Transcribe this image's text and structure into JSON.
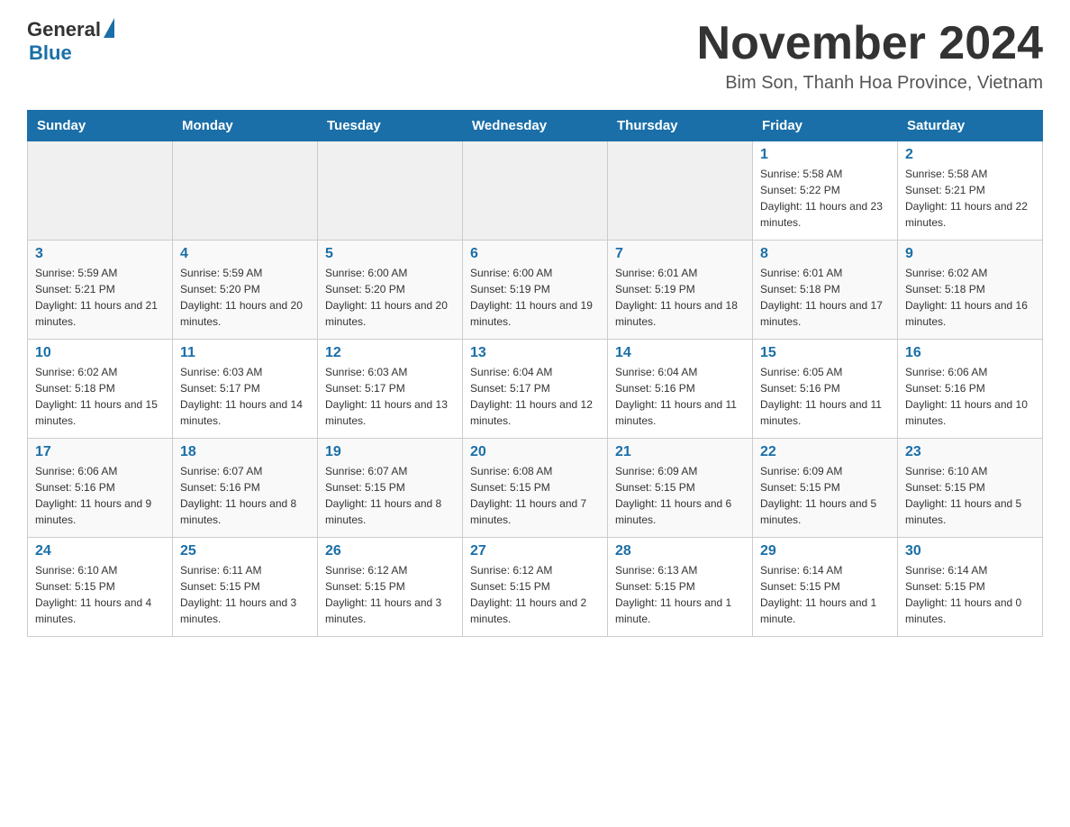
{
  "logo": {
    "general": "General",
    "blue": "Blue"
  },
  "title": "November 2024",
  "subtitle": "Bim Son, Thanh Hoa Province, Vietnam",
  "days_of_week": [
    "Sunday",
    "Monday",
    "Tuesday",
    "Wednesday",
    "Thursday",
    "Friday",
    "Saturday"
  ],
  "weeks": [
    [
      {
        "day": "",
        "info": ""
      },
      {
        "day": "",
        "info": ""
      },
      {
        "day": "",
        "info": ""
      },
      {
        "day": "",
        "info": ""
      },
      {
        "day": "",
        "info": ""
      },
      {
        "day": "1",
        "info": "Sunrise: 5:58 AM\nSunset: 5:22 PM\nDaylight: 11 hours and 23 minutes."
      },
      {
        "day": "2",
        "info": "Sunrise: 5:58 AM\nSunset: 5:21 PM\nDaylight: 11 hours and 22 minutes."
      }
    ],
    [
      {
        "day": "3",
        "info": "Sunrise: 5:59 AM\nSunset: 5:21 PM\nDaylight: 11 hours and 21 minutes."
      },
      {
        "day": "4",
        "info": "Sunrise: 5:59 AM\nSunset: 5:20 PM\nDaylight: 11 hours and 20 minutes."
      },
      {
        "day": "5",
        "info": "Sunrise: 6:00 AM\nSunset: 5:20 PM\nDaylight: 11 hours and 20 minutes."
      },
      {
        "day": "6",
        "info": "Sunrise: 6:00 AM\nSunset: 5:19 PM\nDaylight: 11 hours and 19 minutes."
      },
      {
        "day": "7",
        "info": "Sunrise: 6:01 AM\nSunset: 5:19 PM\nDaylight: 11 hours and 18 minutes."
      },
      {
        "day": "8",
        "info": "Sunrise: 6:01 AM\nSunset: 5:18 PM\nDaylight: 11 hours and 17 minutes."
      },
      {
        "day": "9",
        "info": "Sunrise: 6:02 AM\nSunset: 5:18 PM\nDaylight: 11 hours and 16 minutes."
      }
    ],
    [
      {
        "day": "10",
        "info": "Sunrise: 6:02 AM\nSunset: 5:18 PM\nDaylight: 11 hours and 15 minutes."
      },
      {
        "day": "11",
        "info": "Sunrise: 6:03 AM\nSunset: 5:17 PM\nDaylight: 11 hours and 14 minutes."
      },
      {
        "day": "12",
        "info": "Sunrise: 6:03 AM\nSunset: 5:17 PM\nDaylight: 11 hours and 13 minutes."
      },
      {
        "day": "13",
        "info": "Sunrise: 6:04 AM\nSunset: 5:17 PM\nDaylight: 11 hours and 12 minutes."
      },
      {
        "day": "14",
        "info": "Sunrise: 6:04 AM\nSunset: 5:16 PM\nDaylight: 11 hours and 11 minutes."
      },
      {
        "day": "15",
        "info": "Sunrise: 6:05 AM\nSunset: 5:16 PM\nDaylight: 11 hours and 11 minutes."
      },
      {
        "day": "16",
        "info": "Sunrise: 6:06 AM\nSunset: 5:16 PM\nDaylight: 11 hours and 10 minutes."
      }
    ],
    [
      {
        "day": "17",
        "info": "Sunrise: 6:06 AM\nSunset: 5:16 PM\nDaylight: 11 hours and 9 minutes."
      },
      {
        "day": "18",
        "info": "Sunrise: 6:07 AM\nSunset: 5:16 PM\nDaylight: 11 hours and 8 minutes."
      },
      {
        "day": "19",
        "info": "Sunrise: 6:07 AM\nSunset: 5:15 PM\nDaylight: 11 hours and 8 minutes."
      },
      {
        "day": "20",
        "info": "Sunrise: 6:08 AM\nSunset: 5:15 PM\nDaylight: 11 hours and 7 minutes."
      },
      {
        "day": "21",
        "info": "Sunrise: 6:09 AM\nSunset: 5:15 PM\nDaylight: 11 hours and 6 minutes."
      },
      {
        "day": "22",
        "info": "Sunrise: 6:09 AM\nSunset: 5:15 PM\nDaylight: 11 hours and 5 minutes."
      },
      {
        "day": "23",
        "info": "Sunrise: 6:10 AM\nSunset: 5:15 PM\nDaylight: 11 hours and 5 minutes."
      }
    ],
    [
      {
        "day": "24",
        "info": "Sunrise: 6:10 AM\nSunset: 5:15 PM\nDaylight: 11 hours and 4 minutes."
      },
      {
        "day": "25",
        "info": "Sunrise: 6:11 AM\nSunset: 5:15 PM\nDaylight: 11 hours and 3 minutes."
      },
      {
        "day": "26",
        "info": "Sunrise: 6:12 AM\nSunset: 5:15 PM\nDaylight: 11 hours and 3 minutes."
      },
      {
        "day": "27",
        "info": "Sunrise: 6:12 AM\nSunset: 5:15 PM\nDaylight: 11 hours and 2 minutes."
      },
      {
        "day": "28",
        "info": "Sunrise: 6:13 AM\nSunset: 5:15 PM\nDaylight: 11 hours and 1 minute."
      },
      {
        "day": "29",
        "info": "Sunrise: 6:14 AM\nSunset: 5:15 PM\nDaylight: 11 hours and 1 minute."
      },
      {
        "day": "30",
        "info": "Sunrise: 6:14 AM\nSunset: 5:15 PM\nDaylight: 11 hours and 0 minutes."
      }
    ]
  ]
}
